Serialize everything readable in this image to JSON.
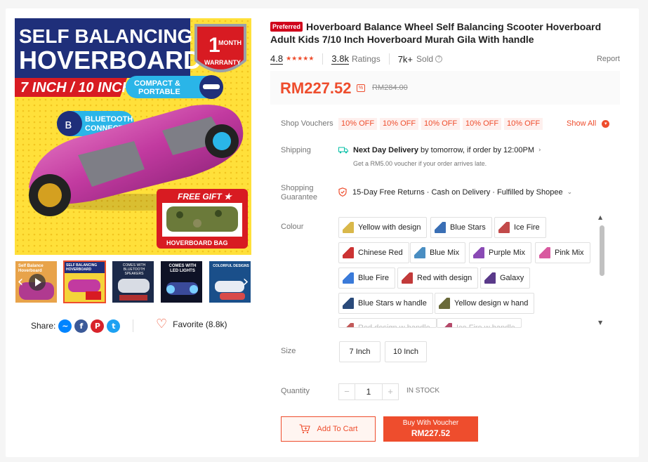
{
  "product": {
    "badge": "Preferred",
    "title": "Hoverboard Balance Wheel Self Balancing Scooter Hoverboard Adult Kids 7/10 Inch Hoverboard Murah Gila With handle",
    "rating": "4.8",
    "stars": "★★★★★",
    "ratings_count": "3.8k",
    "ratings_label": "Ratings",
    "sold_count": "7k+",
    "sold_label": "Sold",
    "report_label": "Report",
    "price": "RM227.52",
    "original_price": "RM284.00"
  },
  "hero_image": {
    "headline_1": "SELF BALANCING",
    "headline_2": "HOVERBOARD",
    "size_banner": "7 INCH / 10 INCH",
    "warranty_1": "1",
    "warranty_2": "MONTH",
    "warranty_3": "WARRANTY",
    "compact_1": "COMPACT &",
    "compact_2": "PORTABLE",
    "bluetooth_1": "BLUETOOTH",
    "bluetooth_2": "CONNECTIVITY",
    "gift_title": "FREE GIFT ★",
    "gift_caption": "HOVERBOARD BAG"
  },
  "thumbnails": [
    {
      "caption": "Self Balance Hoverboard",
      "bg": "#e8a34a"
    },
    {
      "caption": "SELF BALANCING HOVERBOARD",
      "bg": "#f4d43a"
    },
    {
      "caption": "COMES WITH BLUETOOTH SPEAKERS",
      "bg": "#1c2a4a"
    },
    {
      "caption": "COMES WITH LED LIGHTS",
      "bg": "#0e1226"
    },
    {
      "caption": "COLORFUL DESIGNS",
      "bg": "#1a4f8a"
    }
  ],
  "share": {
    "label": "Share:",
    "favorite_label": "Favorite (8.8k)"
  },
  "vouchers": {
    "label": "Shop Vouchers",
    "items": [
      "10% OFF",
      "10% OFF",
      "10% OFF",
      "10% OFF",
      "10% OFF"
    ],
    "show_all": "Show All"
  },
  "shipping": {
    "label": "Shipping",
    "headline_bold": "Next Day Delivery",
    "headline_rest": " by tomorrow, if order by 12:00PM",
    "sub": "Get a RM5.00 voucher if your order arrives late."
  },
  "guarantee": {
    "label_1": "Shopping",
    "label_2": "Guarantee",
    "text": "15-Day Free Returns · Cash on Delivery · Fulfilled by Shopee"
  },
  "colour": {
    "label": "Colour",
    "options": [
      {
        "label": "Yellow with design",
        "swatch": "#d9b84a"
      },
      {
        "label": "Blue Stars",
        "swatch": "#3a6fb5"
      },
      {
        "label": "Ice Fire",
        "swatch": "#c24a4a"
      },
      {
        "label": "Chinese Red",
        "swatch": "#cc3333"
      },
      {
        "label": "Blue Mix",
        "swatch": "#4a8ec2"
      },
      {
        "label": "Purple Mix",
        "swatch": "#8a4ab5"
      },
      {
        "label": "Pink Mix",
        "swatch": "#d95aa0"
      },
      {
        "label": "Blue Fire",
        "swatch": "#3a7ad9"
      },
      {
        "label": "Red with design",
        "swatch": "#c23a3a"
      },
      {
        "label": "Galaxy",
        "swatch": "#5a3a8a"
      },
      {
        "label": "Blue Stars w handle",
        "swatch": "#2a4a7a"
      },
      {
        "label": "Yellow design w hand",
        "swatch": "#6a6a3a"
      },
      {
        "label": "Red design w handle",
        "swatch": "#c25a5a"
      },
      {
        "label": "Ice Fire w handle",
        "swatch": "#b54a6a"
      }
    ]
  },
  "size": {
    "label": "Size",
    "options": [
      "7 Inch",
      "10 Inch"
    ]
  },
  "quantity": {
    "label": "Quantity",
    "minus": "−",
    "value": "1",
    "plus": "+",
    "stock": "IN STOCK"
  },
  "actions": {
    "add_to_cart": "Add To Cart",
    "buy_line_1": "Buy With Voucher",
    "buy_line_2": "RM227.52"
  },
  "colors": {
    "accent": "#ee4d2d",
    "preferred_badge": "#d0011b"
  }
}
